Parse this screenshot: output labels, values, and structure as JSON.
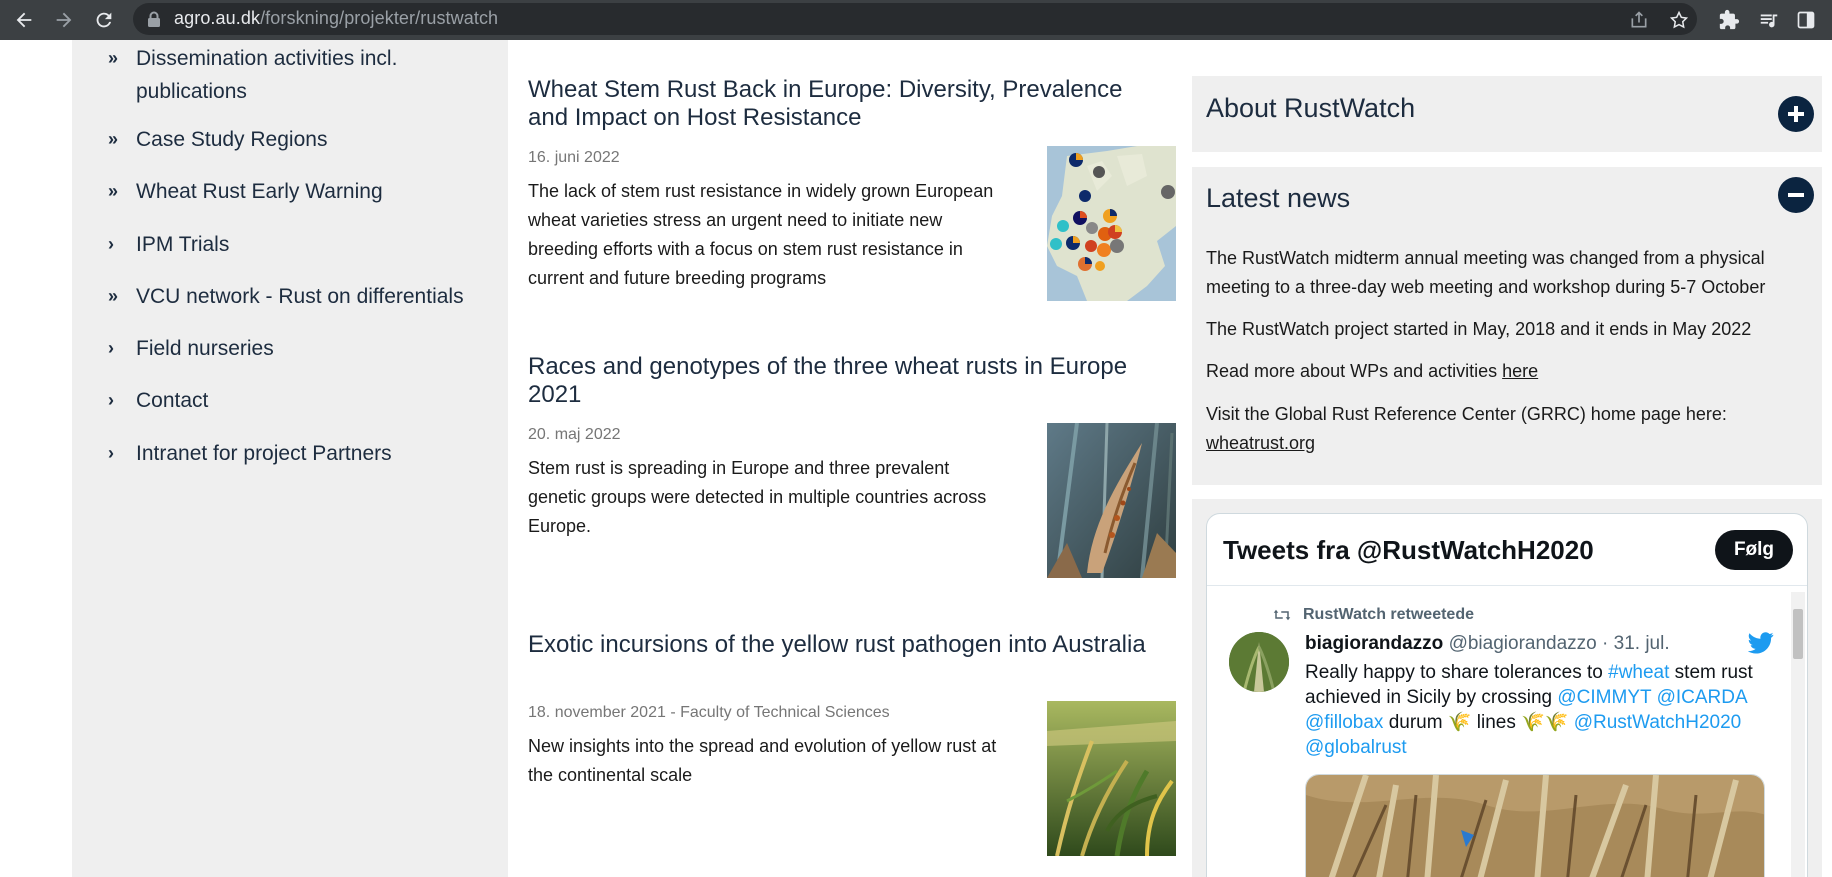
{
  "browser": {
    "url_domain": "agro.au.dk",
    "url_path": "/forskning/projekter/rustwatch",
    "icons": [
      "back-arrow-icon",
      "forward-arrow-icon",
      "reload-icon",
      "lock-icon",
      "share-icon",
      "star-icon",
      "extensions-icon",
      "media-icon",
      "sidebar-icon"
    ]
  },
  "nav": {
    "items": [
      {
        "label": "Dissemination activities incl. publications",
        "chevron": "»"
      },
      {
        "label": "Case Study Regions",
        "chevron": "»"
      },
      {
        "label": "Wheat Rust Early Warning",
        "chevron": "»"
      },
      {
        "label": "IPM Trials",
        "chevron": "›"
      },
      {
        "label": "VCU network - Rust on differentials",
        "chevron": "»"
      },
      {
        "label": "Field nurseries",
        "chevron": "›"
      },
      {
        "label": "Contact",
        "chevron": "›"
      },
      {
        "label": "Intranet for project Partners",
        "chevron": "›"
      }
    ]
  },
  "articles": [
    {
      "title": "Wheat Stem Rust Back in Europe: Diversity, Prevalence and Impact on Host Resistance",
      "date": "16. juni 2022",
      "body": "The lack of stem rust resistance in widely grown European wheat varieties stress an urgent need to initiate new breeding efforts with a focus on stem rust resistance in current and future breeding programs",
      "image": "europe-map-pie-charts"
    },
    {
      "title": "Races and genotypes of the three wheat rusts in Europe 2021",
      "date": "20. maj 2022",
      "body": "Stem rust is spreading in Europe and three prevalent genetic groups were detected in multiple countries across Europe.",
      "image": "rusted-wheat-stem-photo"
    },
    {
      "title": "Exotic incursions of the yellow rust pathogen into Australia",
      "date": "18. november 2021 - Faculty of Technical Sciences",
      "body": "New insights into the spread and evolution of yellow rust at the continental scale",
      "image": "wheat-field-photo"
    }
  ],
  "sidebar": {
    "about": {
      "title": "About RustWatch",
      "toggle": "plus-icon"
    },
    "news": {
      "title": "Latest news",
      "toggle": "minus-icon",
      "p1": "The RustWatch midterm annual meeting was changed from a physical meeting to a three-day web meeting and workshop during 5-7 October",
      "p2": "The RustWatch project started in May, 2018 and it ends in May 2022",
      "p3_text": "Read more about WPs and activities ",
      "p3_link": "here",
      "p4_text": "Visit the Global Rust Reference Center (GRRC) home page here:",
      "p4_link": "wheatrust.org"
    }
  },
  "twitter": {
    "header": "Tweets fra @RustWatchH2020",
    "follow": "Følg",
    "retweet_label": "RustWatch retweetede",
    "tweet": {
      "name": "biagiorandazzo",
      "handle": "@biagiorandazzo",
      "date": "· 31. jul.",
      "text_1": "Really happy to share tolerances to ",
      "tag_1": "#wheat",
      "text_2": " stem rust achieved in Sicily by crossing ",
      "tag_2": "@CIMMYT",
      "tag_3": "@ICARDA",
      "tag_4": "@fillobax",
      "text_3": " durum 🌾 lines 🌾🌾 ",
      "tag_5": "@RustWatchH2020",
      "tag_6": "@globalrust"
    },
    "colors": {
      "link": "#1d9bf0",
      "text": "#0f1419",
      "muted": "#536471"
    }
  },
  "colors": {
    "chrome": "#3c4043",
    "nav_bg": "#efefef",
    "heading": "#1d2c3f",
    "toggle_bg": "#0b2440"
  }
}
